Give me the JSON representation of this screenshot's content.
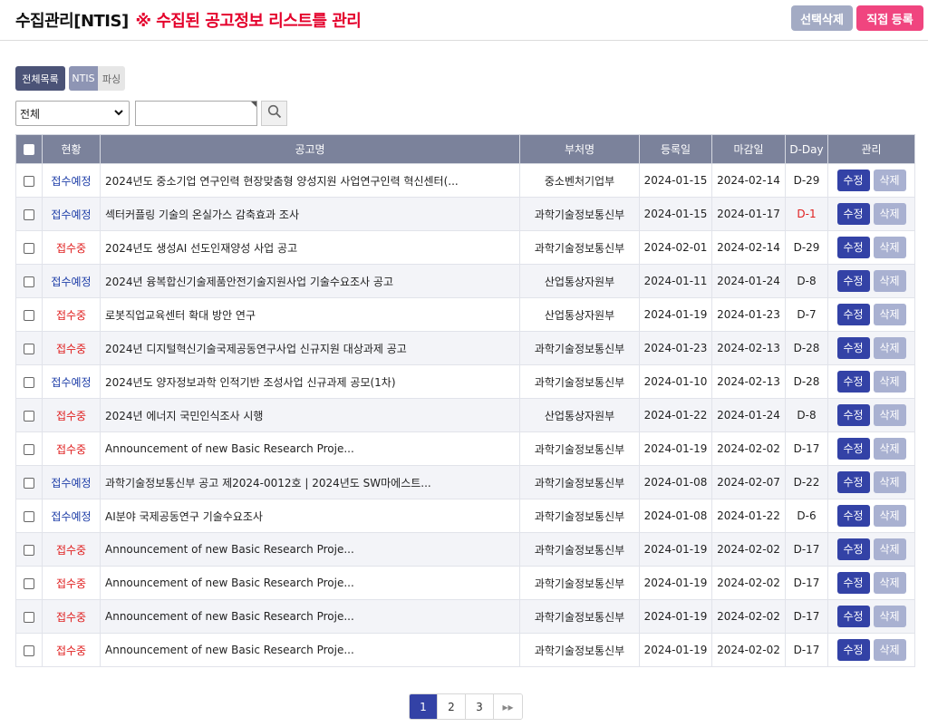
{
  "header": {
    "title": "수집관리[NTIS]",
    "subtitle": "※ 수집된 공고정보 리스트를 관리",
    "select_delete_label": "선택삭제",
    "direct_register_label": "직접 등록"
  },
  "tabs": {
    "all_label": "전체목록",
    "ntis_label": "NTIS",
    "parse_label": "파싱"
  },
  "filter": {
    "selected": "전체",
    "search_value": ""
  },
  "table": {
    "columns": [
      "현황",
      "공고명",
      "부처명",
      "등록일",
      "마감일",
      "D-Day",
      "관리"
    ],
    "edit_label": "수정",
    "delete_label": "삭제",
    "rows": [
      {
        "status": "접수예정",
        "title": "2024년도 중소기업 연구인력 현장맞춤형 양성지원 사업연구인력 혁신센터(...",
        "ministry": "중소벤처기업부",
        "reg": "2024-01-15",
        "due": "2024-02-14",
        "dday": "D-29"
      },
      {
        "status": "접수예정",
        "title": "섹터커플링 기술의 온실가스 감축효과 조사",
        "ministry": "과학기술정보통신부",
        "reg": "2024-01-15",
        "due": "2024-01-17",
        "dday": "D-1"
      },
      {
        "status": "접수중",
        "title": "2024년도 생성AI 선도인재양성 사업 공고",
        "ministry": "과학기술정보통신부",
        "reg": "2024-02-01",
        "due": "2024-02-14",
        "dday": "D-29"
      },
      {
        "status": "접수예정",
        "title": "2024년 융복합신기술제품안전기술지원사업 기술수요조사 공고",
        "ministry": "산업통상자원부",
        "reg": "2024-01-11",
        "due": "2024-01-24",
        "dday": "D-8"
      },
      {
        "status": "접수중",
        "title": "로봇직업교육센터 확대 방안 연구",
        "ministry": "산업통상자원부",
        "reg": "2024-01-19",
        "due": "2024-01-23",
        "dday": "D-7"
      },
      {
        "status": "접수중",
        "title": "2024년 디지털혁신기술국제공동연구사업 신규지원 대상과제 공고",
        "ministry": "과학기술정보통신부",
        "reg": "2024-01-23",
        "due": "2024-02-13",
        "dday": "D-28"
      },
      {
        "status": "접수예정",
        "title": "2024년도 양자정보과학 인적기반 조성사업 신규과제 공모(1차)",
        "ministry": "과학기술정보통신부",
        "reg": "2024-01-10",
        "due": "2024-02-13",
        "dday": "D-28"
      },
      {
        "status": "접수중",
        "title": "2024년 에너지 국민인식조사 시행",
        "ministry": "산업통상자원부",
        "reg": "2024-01-22",
        "due": "2024-01-24",
        "dday": "D-8"
      },
      {
        "status": "접수중",
        "title": "Announcement of new Basic Research Proje...",
        "ministry": "과학기술정보통신부",
        "reg": "2024-01-19",
        "due": "2024-02-02",
        "dday": "D-17"
      },
      {
        "status": "접수예정",
        "title": "과학기술정보통신부 공고 제2024-0012호 | 2024년도 SW마에스트...",
        "ministry": "과학기술정보통신부",
        "reg": "2024-01-08",
        "due": "2024-02-07",
        "dday": "D-22"
      },
      {
        "status": "접수예정",
        "title": "AI분야 국제공동연구 기술수요조사",
        "ministry": "과학기술정보통신부",
        "reg": "2024-01-08",
        "due": "2024-01-22",
        "dday": "D-6"
      },
      {
        "status": "접수중",
        "title": "Announcement of new Basic Research Proje...",
        "ministry": "과학기술정보통신부",
        "reg": "2024-01-19",
        "due": "2024-02-02",
        "dday": "D-17"
      },
      {
        "status": "접수중",
        "title": "Announcement of new Basic Research Proje...",
        "ministry": "과학기술정보통신부",
        "reg": "2024-01-19",
        "due": "2024-02-02",
        "dday": "D-17"
      },
      {
        "status": "접수중",
        "title": "Announcement of new Basic Research Proje...",
        "ministry": "과학기술정보통신부",
        "reg": "2024-01-19",
        "due": "2024-02-02",
        "dday": "D-17"
      },
      {
        "status": "접수중",
        "title": "Announcement of new Basic Research Proje...",
        "ministry": "과학기술정보통신부",
        "reg": "2024-01-19",
        "due": "2024-02-02",
        "dday": "D-17"
      }
    ]
  },
  "pagination": {
    "pages": [
      "1",
      "2",
      "3"
    ],
    "current": "1",
    "next_label": "▸▸"
  }
}
